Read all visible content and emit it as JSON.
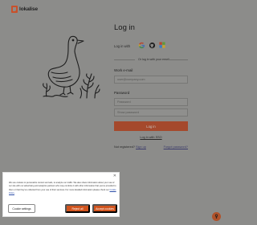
{
  "brand": {
    "name": "lokalise",
    "accent": "#c8512b"
  },
  "login": {
    "title": "Log in",
    "login_with": "Log in with",
    "providers": [
      "google-icon",
      "github-icon",
      "microsoft-icon"
    ],
    "divider": "Or log in with your email",
    "email_label": "Work e-mail",
    "email_placeholder": "user@company.com",
    "password_label": "Password",
    "password_placeholder": "Password",
    "confirm_placeholder": "Show password",
    "login_button": "Log in",
    "sso_link": "Log in with SSO",
    "signup_prompt": "Not registered?",
    "signup_link": "Sign up",
    "forgot_link": "Forgot password?"
  },
  "cookie": {
    "text": "We use cookies to personalize content and ads, to analyze our traffic. We also share information about your use of our site with our advertising and analytics partners who may combine it with other information that you've provided to them or that they've collected from your use of their services. For more detailed information please check our",
    "policy_link": "Cookie Policy",
    "close": "✕",
    "settings_button": "Cookie settings",
    "reject_button": "Reject all",
    "accept_button": "Accept cookies"
  },
  "help": {
    "icon": "help-icon"
  }
}
